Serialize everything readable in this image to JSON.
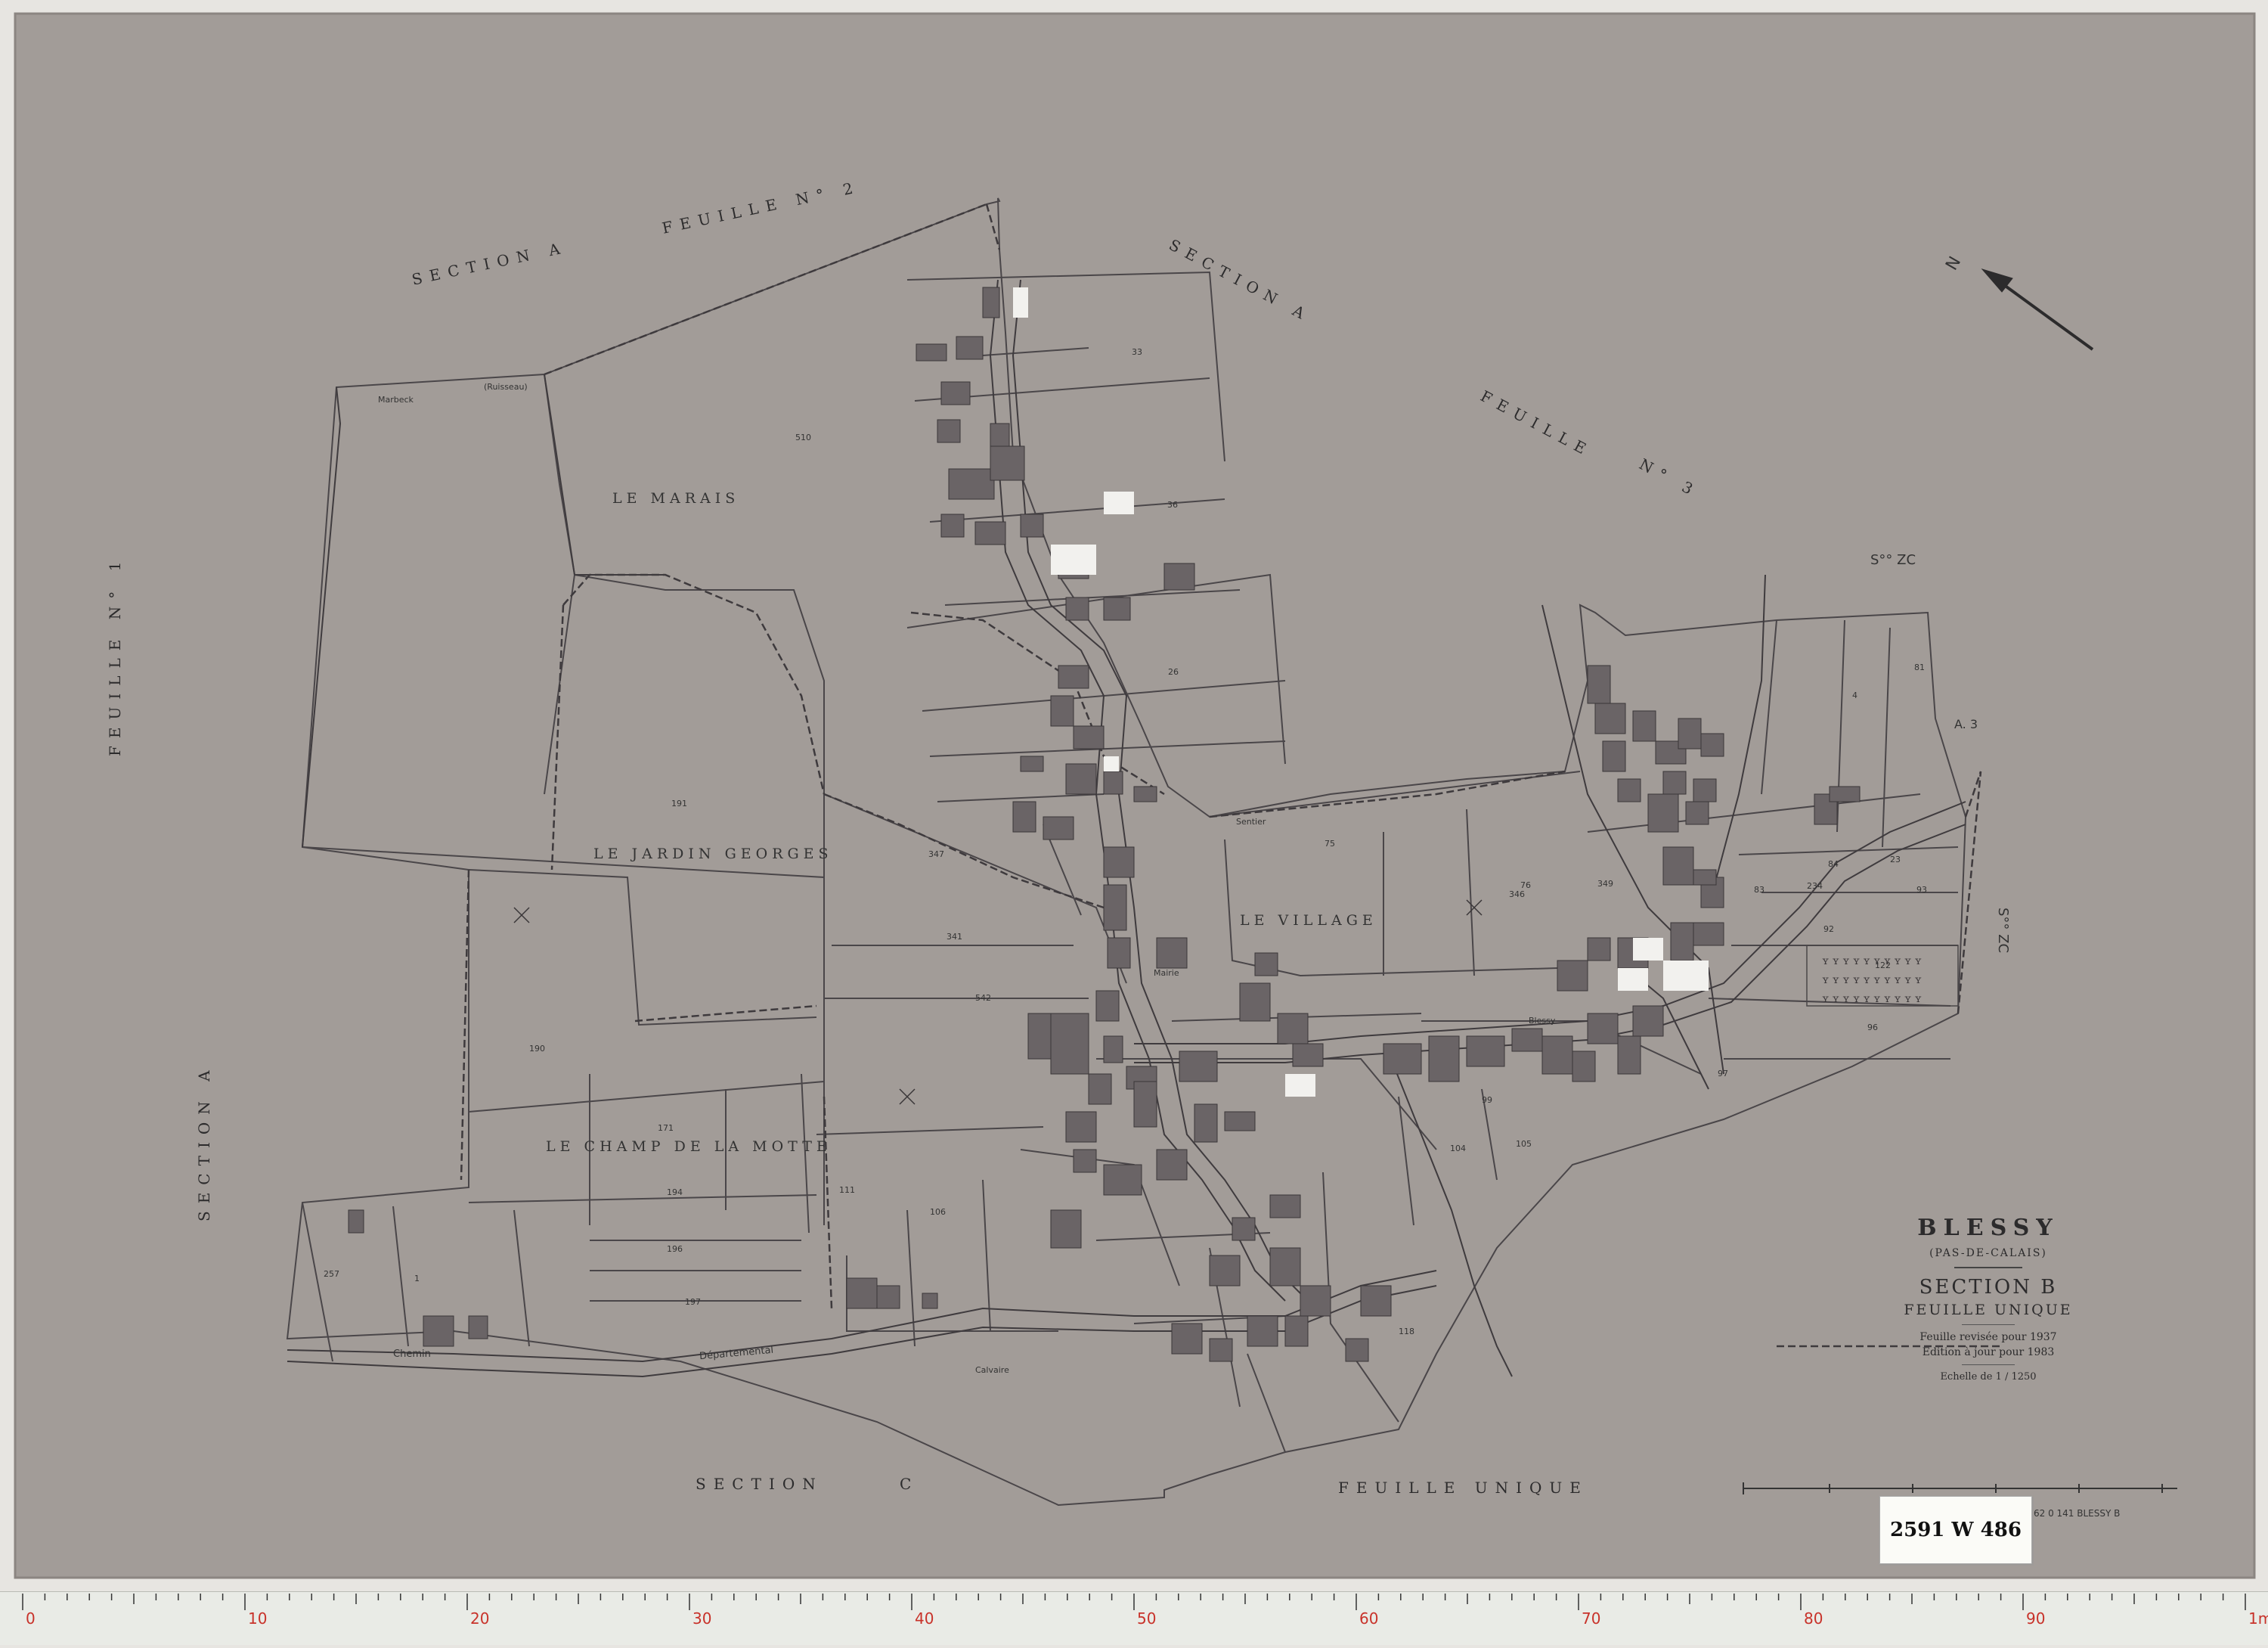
{
  "map": {
    "town": "BLESSY",
    "department": "(PAS-DE-CALAIS)",
    "section": "SECTION  B",
    "sheet": "FEUILLE UNIQUE",
    "revision": "Feuille revisée pour 1937",
    "edition": "Edition à jour pour 1983",
    "scale": "Echelle de  1 / 1250",
    "archive_ref": "2591 W 486",
    "footer_ref": "62 0 141  BLESSY  B",
    "north_arrow_letter": "N",
    "neighbours": {
      "top_left_a": "SECTION  A",
      "top_left_b": "FEUILLE   N° 2",
      "top_right_a": "SECTION  A",
      "top_right_b": "FEUILLE",
      "top_right_c": "N° 3",
      "left_a": "FEUILLE   N° 1",
      "left_b": "SECTION   A",
      "bottom_a": "SECTION",
      "bottom_b": "C",
      "bottom_c": "FEUILLE     UNIQUE",
      "right_zc_a": "S°° ZC",
      "right_zc_b": "S°° ZC",
      "right_a3": "A. 3"
    },
    "lieux_dits": [
      "LE MARAIS",
      "LE JARDIN GEORGES",
      "LE VILLAGE",
      "LE CHAMP DE LA MOTTE"
    ],
    "road_labels": [
      "Chemin",
      "Départemental",
      "Mairie",
      "Calvaire",
      "Sentier",
      "Marbeck",
      "(Ruisseau)",
      "Blessy"
    ],
    "parcels": [
      "510",
      "191",
      "190",
      "171",
      "194",
      "196",
      "197",
      "347",
      "341",
      "542",
      "33",
      "36",
      "26",
      "75",
      "76",
      "93",
      "96",
      "122",
      "23",
      "97",
      "4",
      "81",
      "257",
      "1",
      "111",
      "106",
      "118",
      "234",
      "346",
      "349",
      "99",
      "104",
      "105",
      "92",
      "83",
      "84"
    ]
  },
  "ruler": {
    "labels": [
      "0",
      "10",
      "20",
      "30",
      "40",
      "50",
      "60",
      "70",
      "80",
      "90",
      "1m"
    ]
  },
  "colors": {
    "paper": "#a29c98",
    "building": "#6a6466",
    "lines": "#4a4649",
    "ruler_red": "#c8322a"
  }
}
